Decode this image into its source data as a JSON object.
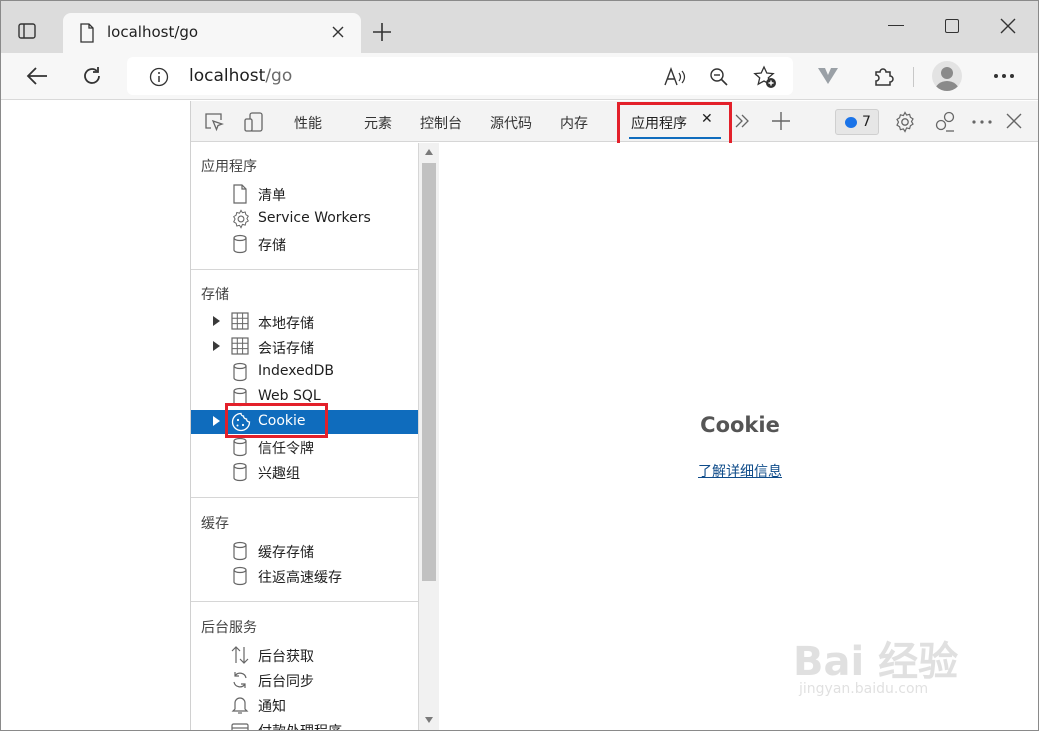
{
  "browser": {
    "tab_title": "localhost/go",
    "url_host": "localhost",
    "url_path": "/go"
  },
  "devtools": {
    "tabs": [
      "性能",
      "元素",
      "控制台",
      "源代码",
      "内存"
    ],
    "active_tab": "应用程序",
    "issues_count": "7",
    "sidebar": {
      "app_section": "应用程序",
      "app_items": [
        "清单",
        "Service Workers",
        "存储"
      ],
      "storage_section": "存储",
      "storage_items": [
        "本地存储",
        "会话存储",
        "IndexedDB",
        "Web SQL",
        "Cookie",
        "信任令牌",
        "兴趣组"
      ],
      "cache_section": "缓存",
      "cache_items": [
        "缓存存储",
        "往返高速缓存"
      ],
      "bg_section": "后台服务",
      "bg_items": [
        "后台获取",
        "后台同步",
        "通知",
        "付款处理程序"
      ]
    },
    "main": {
      "title": "Cookie",
      "learn_more": "了解详细信息"
    }
  },
  "watermark": {
    "text": "Bai 经验",
    "sub": "jingyan.baidu.com"
  },
  "colors": {
    "accent": "#0f6cbd",
    "highlight_box": "#e3202a"
  }
}
